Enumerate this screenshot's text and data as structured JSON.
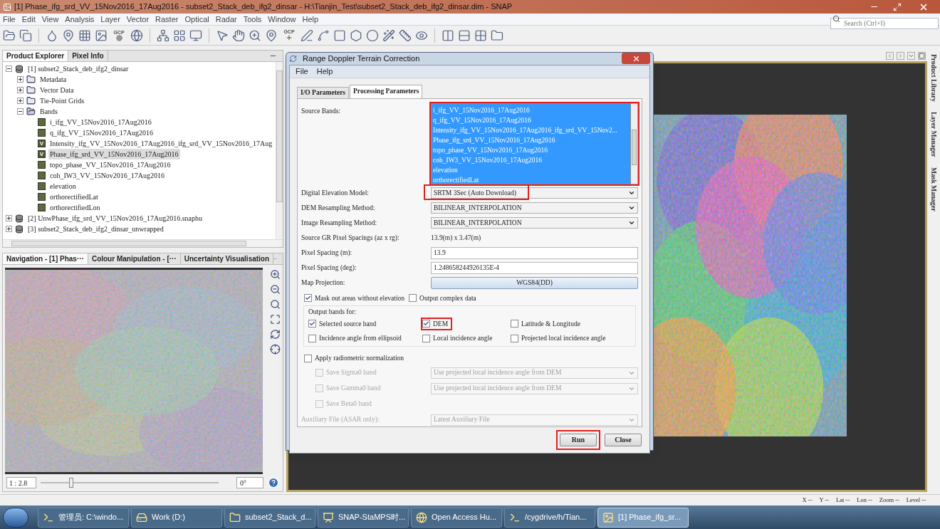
{
  "window": {
    "title": "[1] Phase_ifg_srd_VV_15Nov2016_17Aug2016 - subset2_Stack_deb_ifg2_dinsar - H:\\Tianjin_Test\\subset2_Stack_deb_ifg2_dinsar.dim - SNAP"
  },
  "menu": [
    "File",
    "Edit",
    "View",
    "Analysis",
    "Layer",
    "Vector",
    "Raster",
    "Optical",
    "Radar",
    "Tools",
    "Window",
    "Help"
  ],
  "search": {
    "placeholder": "Search (Ctrl+I)"
  },
  "toolbar": [
    {
      "kind": "open"
    },
    {
      "kind": "session"
    },
    {
      "kind": "sep"
    },
    {
      "kind": "mask"
    },
    {
      "kind": "pins"
    },
    {
      "kind": "graticule"
    },
    {
      "kind": "figure"
    },
    {
      "kind": "gcp",
      "label": "GCP"
    },
    {
      "kind": "world"
    },
    {
      "kind": "sep"
    },
    {
      "kind": "graph"
    },
    {
      "kind": "batch"
    },
    {
      "kind": "pixel"
    },
    {
      "kind": "sep"
    },
    {
      "kind": "select"
    },
    {
      "kind": "pan"
    },
    {
      "kind": "zoom"
    },
    {
      "kind": "pin-add"
    },
    {
      "kind": "gcp-add",
      "label": "GCP"
    },
    {
      "kind": "line"
    },
    {
      "kind": "polyline"
    },
    {
      "kind": "rect"
    },
    {
      "kind": "polygon"
    },
    {
      "kind": "ellipse"
    },
    {
      "kind": "magic"
    },
    {
      "kind": "range"
    },
    {
      "kind": "inspect"
    },
    {
      "kind": "sep"
    },
    {
      "kind": "tile-h"
    },
    {
      "kind": "tile-v"
    },
    {
      "kind": "tile-grid"
    },
    {
      "kind": "tile-none"
    }
  ],
  "explorer": {
    "tabs": [
      {
        "label": "Product Explorer",
        "selected": true
      },
      {
        "label": "Pixel Info",
        "selected": false
      }
    ],
    "tree": [
      {
        "kind": "product",
        "label": "[1] subset2_Stack_deb_ifg2_dinsar",
        "expanded": true,
        "selected": false,
        "children": [
          {
            "kind": "folder",
            "label": "Metadata",
            "expanded": false,
            "selected": false
          },
          {
            "kind": "folder",
            "label": "Vector Data",
            "expanded": false,
            "selected": false
          },
          {
            "kind": "folder",
            "label": "Tie-Point Grids",
            "expanded": false,
            "selected": false
          },
          {
            "kind": "folder",
            "label": "Bands",
            "expanded": true,
            "selected": false,
            "children": [
              {
                "kind": "band",
                "label": "i_ifg_VV_15Nov2016_17Aug2016",
                "selected": false
              },
              {
                "kind": "band",
                "label": "q_ifg_VV_15Nov2016_17Aug2016",
                "selected": false
              },
              {
                "kind": "virtual",
                "badge": "V",
                "label": "Intensity_ifg_VV_15Nov2016_17Aug2016_ifg_srd_VV_15Nov2016_17Aug",
                "selected": false
              },
              {
                "kind": "virtual",
                "badge": "V",
                "label": "Phase_ifg_srd_VV_15Nov2016_17Aug2016",
                "selected": true
              },
              {
                "kind": "band",
                "label": "topo_phase_VV_15Nov2016_17Aug2016",
                "selected": false
              },
              {
                "kind": "band",
                "label": "coh_IW3_VV_15Nov2016_17Aug2016",
                "selected": false
              },
              {
                "kind": "band",
                "label": "elevation",
                "selected": false
              },
              {
                "kind": "band",
                "label": "orthorectifiedLat",
                "selected": false
              },
              {
                "kind": "band",
                "label": "orthorectifiedLon",
                "selected": false
              }
            ]
          }
        ]
      },
      {
        "kind": "product",
        "label": "[2] UnwPhase_ifg_srd_VV_15Nov2016_17Aug2016.snaphu",
        "expanded": false,
        "selected": false
      },
      {
        "kind": "product",
        "label": "[3] subset2_Stack_deb_ifg2_dinsar_unwrapped",
        "expanded": false,
        "selected": false
      }
    ]
  },
  "navigation": {
    "tabs": [
      {
        "label": "Navigation - [1] Phas···",
        "selected": true
      },
      {
        "label": "Colour Manipulation - [···",
        "selected": false
      },
      {
        "label": "Uncertainty Visualisation",
        "selected": false
      }
    ],
    "scale": "1 : 2.8",
    "level": 0.17,
    "rotation": "0°"
  },
  "side_tabs": [
    "Product Library",
    "Layer Manager",
    "Mask Manager"
  ],
  "status_bar": [
    {
      "label": "X",
      "value": "--"
    },
    {
      "label": "Y",
      "value": "--"
    },
    {
      "label": "Lat",
      "value": "--"
    },
    {
      "label": "Lon",
      "value": "--"
    },
    {
      "label": "Zoom",
      "value": "--"
    },
    {
      "label": "Level",
      "value": "--"
    }
  ],
  "taskbar": [
    {
      "kind": "terminal",
      "label": "管理员: C:\\windo...",
      "selected": false
    },
    {
      "kind": "drive",
      "label": "Work (D:)",
      "selected": false
    },
    {
      "kind": "folder",
      "label": "subset2_Stack_d...",
      "selected": false
    },
    {
      "kind": "slides",
      "label": "SNAP-StaMPS时...",
      "selected": false
    },
    {
      "kind": "browser",
      "label": "Open Access Hu...",
      "selected": false
    },
    {
      "kind": "console",
      "label": "/cygdrive/h/Tian...",
      "selected": false
    },
    {
      "kind": "app",
      "label": "[1] Phase_ifg_sr...",
      "selected": true
    }
  ],
  "dialog": {
    "title": "Range Doppler Terrain Correction",
    "menu": [
      "File",
      "Help"
    ],
    "tabs": [
      {
        "label": "I/O Parameters",
        "selected": false
      },
      {
        "label": "Processing Parameters",
        "selected": true
      }
    ],
    "source_bands": {
      "label": "Source Bands:",
      "highlighted": true,
      "items": [
        {
          "label": "i_ifg_VV_15Nov2016_17Aug2016",
          "selected": true
        },
        {
          "label": "q_ifg_VV_15Nov2016_17Aug2016",
          "selected": true
        },
        {
          "label": "Intensity_ifg_VV_15Nov2016_17Aug2016_ifg_srd_VV_15Nov2...",
          "selected": true
        },
        {
          "label": "Phase_ifg_srd_VV_15Nov2016_17Aug2016",
          "selected": true
        },
        {
          "label": "topo_phase_VV_15Nov2016_17Aug2016",
          "selected": true
        },
        {
          "label": "coh_IW3_VV_15Nov2016_17Aug2016",
          "selected": true
        },
        {
          "label": "elevation",
          "selected": true
        },
        {
          "label": "orthorectifiedLat",
          "selected": true
        }
      ]
    },
    "fields": [
      {
        "kind": "select",
        "label": "Digital Elevation Model:",
        "value": "SRTM 3Sec (Auto Download)",
        "highlighted": true
      },
      {
        "kind": "select",
        "label": "DEM Resampling Method:",
        "value": "BILINEAR_INTERPOLATION",
        "highlighted": false
      },
      {
        "kind": "select",
        "label": "Image Resampling Method:",
        "value": "BILINEAR_INTERPOLATION",
        "highlighted": false
      },
      {
        "kind": "text",
        "label": "Source GR Pixel Spacings (az x rg):",
        "value": "13.9(m) x 3.47(m)"
      },
      {
        "kind": "input",
        "label": "Pixel Spacing (m):",
        "value": "13.9"
      },
      {
        "kind": "input",
        "label": "Pixel Spacing (deg):",
        "value": "1.248658244926135E-4"
      },
      {
        "kind": "button",
        "label": "Map Projection:",
        "value": "WGS84(DD)"
      }
    ],
    "options": [
      {
        "label": "Mask out areas without elevation",
        "checked": true
      },
      {
        "label": "Output complex data",
        "checked": false
      }
    ],
    "output_bands": {
      "title": "Output bands for:",
      "items": [
        {
          "label": "Selected source band",
          "checked": true,
          "highlighted": false
        },
        {
          "label": "DEM",
          "checked": true,
          "highlighted": true
        },
        {
          "label": "Latitude & Longitude",
          "checked": false,
          "highlighted": false
        },
        {
          "label": "Incidence angle from ellipsoid",
          "checked": false,
          "highlighted": false
        },
        {
          "label": "Local incidence angle",
          "checked": false,
          "highlighted": false
        },
        {
          "label": "Projected local incidence angle",
          "checked": false,
          "highlighted": false
        }
      ]
    },
    "radiometric": {
      "label": "Apply radiometric normalization",
      "checked": false,
      "rows": [
        {
          "label": "Save Sigma0 band",
          "checked": false,
          "disabled": true,
          "value": "Use projected local incidence angle from DEM"
        },
        {
          "label": "Save Gamma0 band",
          "checked": false,
          "disabled": true,
          "value": "Use projected local incidence angle from DEM"
        },
        {
          "label": "Save Beta0 band",
          "checked": false,
          "disabled": true
        }
      ]
    },
    "auxiliary": {
      "label": "Auxiliary File (ASAR only):",
      "value": "Latest Auxiliary File",
      "disabled": true
    },
    "buttons": [
      {
        "label": "Run",
        "highlighted": true
      },
      {
        "label": "Close",
        "highlighted": false
      }
    ]
  }
}
